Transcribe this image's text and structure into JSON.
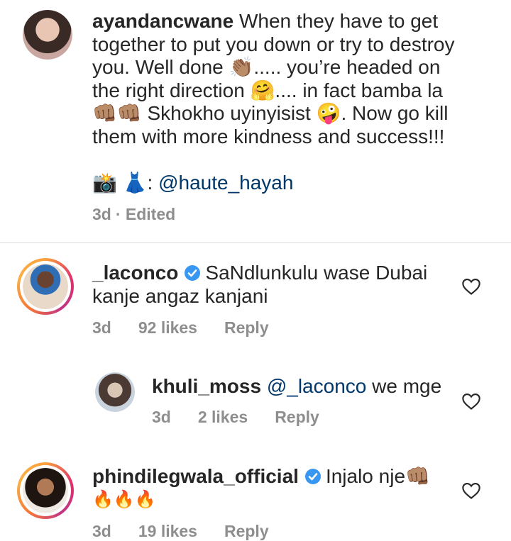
{
  "caption": {
    "username": "ayandancwane",
    "lines": [
      "When they have to get",
      "together to put you down or try to destroy",
      "you. Well done 👏🏽..... you’re headed on",
      "the right direction 🤗.... in fact bamba la",
      "👊🏽👊🏽 Skhokho uyinyisist 🤪. Now go kill",
      "them with more kindness and success!!!"
    ],
    "credit_prefix": "📸 👗:",
    "credit_mention": "@haute_hayah",
    "time": "3d",
    "edited": "· Edited"
  },
  "comments": [
    {
      "username": "_laconco",
      "verified": true,
      "line1": "SaNdlunkulu wase Dubai",
      "line2": "kanje angaz kanjani",
      "time": "3d",
      "likes": "92 likes",
      "reply": "Reply"
    },
    {
      "username": "khuli_moss",
      "mention": "@_laconco",
      "text": "we mge",
      "time": "3d",
      "likes": "2 likes",
      "reply": "Reply"
    },
    {
      "username": "phindilegwala_official",
      "verified": true,
      "line1": "Injalo nje👊🏽",
      "line2": "🔥🔥🔥",
      "time": "3d",
      "likes": "19 likes",
      "reply": "Reply"
    }
  ],
  "colors": {
    "text": "#262626",
    "muted": "#8e8e8e",
    "mention": "#00376b",
    "verified": "#3897f0"
  }
}
